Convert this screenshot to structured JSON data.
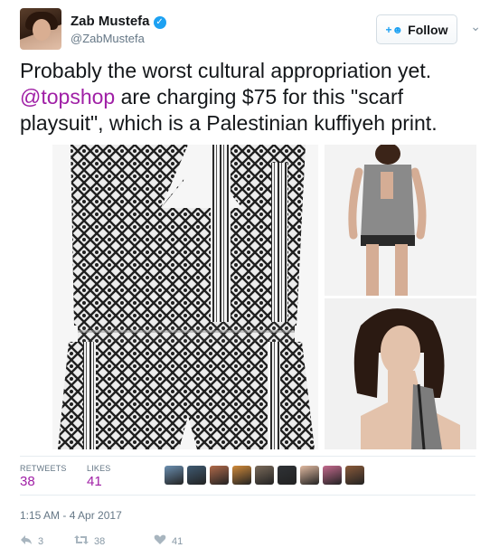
{
  "header": {
    "display_name": "Zab Mustefa",
    "verified_glyph": "✓",
    "handle": "@ZabMustefa",
    "follow_label": "Follow",
    "follow_icon_glyph": "+",
    "caret_glyph": "⌄"
  },
  "tweet": {
    "text_before": "Probably the worst cultural appropriation yet.",
    "mention": "@topshop",
    "text_after": " are charging $75 for this \"scarf playsuit\", which is a Palestinian kuffiyeh print."
  },
  "media": {
    "main": "kuffiyeh-playsuit-product-photo",
    "top_right": "model-back-view-photo",
    "bottom_right": "model-portrait-photo"
  },
  "stats": {
    "retweets_label": "RETWEETS",
    "retweets_value": "38",
    "likes_label": "LIKES",
    "likes_value": "41",
    "liker_avatar_colors": [
      "#6b8fb0",
      "#3f5a72",
      "#b06a4a",
      "#d08a3a",
      "#7a6a5a",
      "#2f3236",
      "#e0b9a0",
      "#c46a8e",
      "#8a5a3a"
    ]
  },
  "timestamp": "1:15 AM - 4 Apr 2017",
  "actions": {
    "reply_icon": "reply-icon",
    "reply_count": "3",
    "retweet_icon": "retweet-icon",
    "retweet_count": "38",
    "like_icon": "heart-icon",
    "like_count": "41"
  },
  "colors": {
    "mention": "#a020a6",
    "verified": "#1da1f2",
    "stat_value": "#a020a6"
  }
}
